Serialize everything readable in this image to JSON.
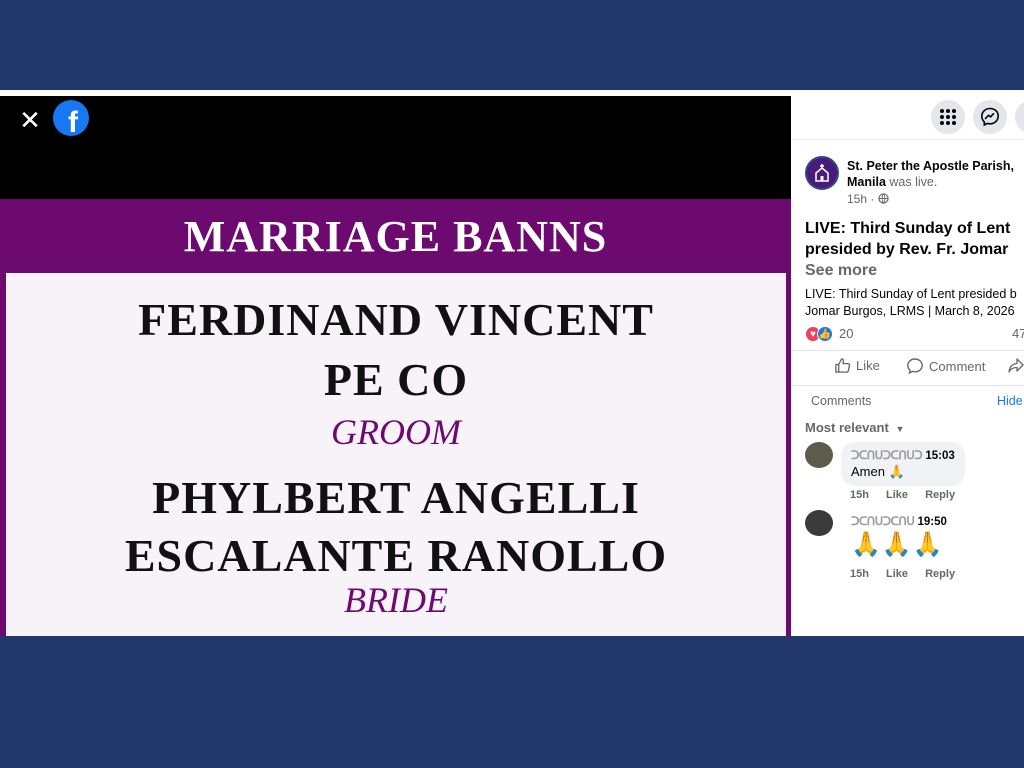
{
  "video": {
    "close_symbol": "✕",
    "logo_letter": "f",
    "banner_title": "MARRIAGE BANNS",
    "groom_line1": "FERDINAND VINCENT",
    "groom_line2": "PE CO",
    "groom_role": "GROOM",
    "bride_line1": "PHYLBERT ANGELLI",
    "bride_line2": "ESCALANTE RANOLLO",
    "bride_role": "BRIDE"
  },
  "panel": {
    "page_name": "St. Peter the Apostle Parish, Manila",
    "page_status": "was live.",
    "post_time": "15h ·",
    "privacy_icon": "globe-icon",
    "headline_line1": "LIVE: Third Sunday of Lent",
    "headline_line2": "presided by Rev. Fr. Jomar",
    "see_more": "See more",
    "desc_line1": "LIVE: Third Sunday of Lent presided b",
    "desc_line2": "Jomar Burgos, LRMS | March 8, 2026",
    "reaction_count": "20",
    "comment_count": "47",
    "like_label": "Like",
    "comment_label": "Comment",
    "comments_heading": "Comments",
    "hide_label": "Hide",
    "sort_label": "Most relevant",
    "comments": [
      {
        "name_obscured": "ᑐᑕᑎᑌᑐᑕᑎᑌᑐ",
        "time_tag": "15:03",
        "text": "Amen 🙏",
        "age": "15h",
        "like": "Like",
        "reply": "Reply"
      },
      {
        "name_obscured": "ᑐᑕᑎᑌᑐᑕᑎᑌ",
        "time_tag": "19:50",
        "text": "🙏🙏🙏",
        "age": "15h",
        "like": "Like",
        "reply": "Reply"
      }
    ]
  },
  "colors": {
    "background": "#22386b",
    "banner_purple": "#6d0a6f",
    "facebook_blue": "#1877f2"
  }
}
